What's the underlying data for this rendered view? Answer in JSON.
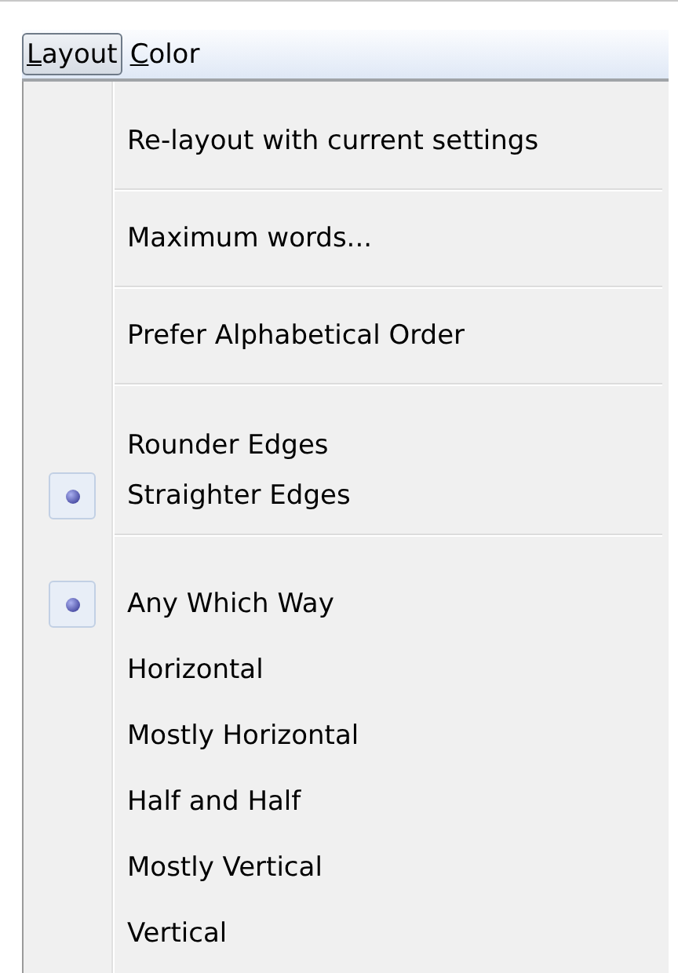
{
  "menu_bar": [
    {
      "key": "L",
      "rest": "ayout",
      "selected": true
    },
    {
      "key": "C",
      "rest": "olor",
      "selected": false
    }
  ],
  "menu_groups": [
    [
      {
        "label": "Re-layout with current settings",
        "kind": "command"
      }
    ],
    [
      {
        "label": "Maximum words...",
        "kind": "command"
      }
    ],
    [
      {
        "label": "Prefer Alphabetical Order",
        "kind": "command"
      }
    ],
    [
      {
        "label": "Rounder Edges",
        "kind": "radio",
        "selected": false
      },
      {
        "label": "Straighter Edges",
        "kind": "radio",
        "selected": true
      }
    ],
    [
      {
        "label": "Any Which Way",
        "kind": "radio",
        "selected": true
      },
      {
        "label": "Horizontal",
        "kind": "radio",
        "selected": false
      },
      {
        "label": "Mostly Horizontal",
        "kind": "radio",
        "selected": false
      },
      {
        "label": "Half and Half",
        "kind": "radio",
        "selected": false
      },
      {
        "label": "Mostly Vertical",
        "kind": "radio",
        "selected": false
      },
      {
        "label": "Vertical",
        "kind": "radio",
        "selected": false
      }
    ]
  ]
}
